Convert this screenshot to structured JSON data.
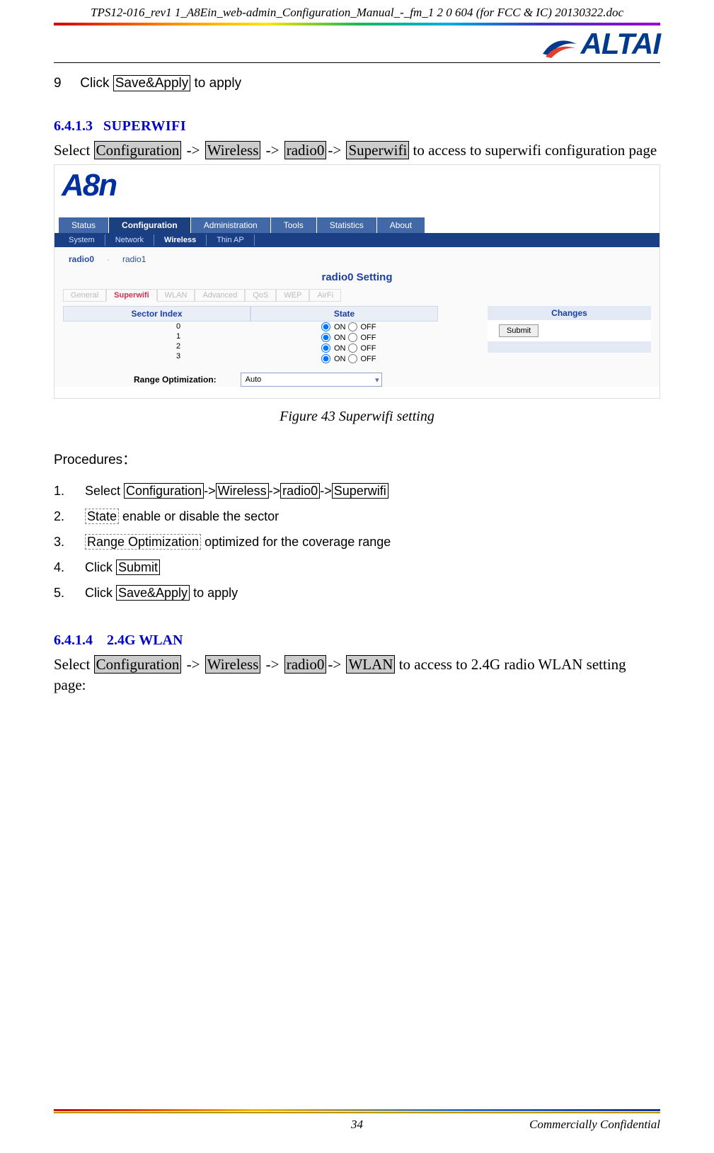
{
  "doc": {
    "header": "TPS12-016_rev1 1_A8Ein_web-admin_Configuration_Manual_-_fm_1 2 0 604 (for FCC & IC) 20130322.doc",
    "logo": "ALTAI"
  },
  "step9": {
    "num": "9",
    "pre": "Click ",
    "btn": "Save&Apply",
    "post": " to apply"
  },
  "sec_6413": {
    "num": "6.4.1.3",
    "title": "SUPERWIFI",
    "lead": "Select ",
    "b1": "Configuration",
    "arrow": " -> ",
    "b2": "Wireless",
    "b3": "radio0",
    "arrow2": "-> ",
    "b4": "Superwifi",
    "tail": " to access to superwifi configuration page"
  },
  "fig": {
    "logo": "A8n",
    "tabs1": [
      "Status",
      "Configuration",
      "Administration",
      "Tools",
      "Statistics",
      "About"
    ],
    "active1": 1,
    "subtabs": [
      "System",
      "Network",
      "Wireless",
      "Thin AP"
    ],
    "subactive": 2,
    "radios": [
      "radio0",
      "radio1"
    ],
    "rsep": "-",
    "ractive": 0,
    "title": "radio0 Setting",
    "ctabs": [
      "General",
      "Superwifi",
      "WLAN",
      "Advanced",
      "QoS",
      "WEP",
      "AirFi"
    ],
    "cactive": 1,
    "th1": "Sector Index",
    "th2": "State",
    "sectors": [
      "0",
      "1",
      "2",
      "3"
    ],
    "on": "ON",
    "off": "OFF",
    "range_label": "Range Optimization:",
    "range_val": "Auto",
    "changes": "Changes",
    "submit": "Submit"
  },
  "caption": "Figure 43 Superwifi setting",
  "procedures_label": "Procedures：",
  "proc": {
    "p1": {
      "n": "1.",
      "pre": "Select ",
      "a": "Configuration",
      "b": "Wireless",
      "c": "radio0",
      "d": "Superwifi",
      "sep": "->"
    },
    "p2": {
      "n": "2.",
      "a": "State",
      "t": " enable or disable the sector"
    },
    "p3": {
      "n": "3.",
      "a": "Range Optimization",
      "t": " optimized for the coverage range"
    },
    "p4": {
      "n": "4.",
      "pre": "Click ",
      "a": "Submit"
    },
    "p5": {
      "n": "5.",
      "pre": "Click ",
      "a": "Save&Apply",
      "t": " to apply"
    }
  },
  "sec_6414": {
    "num": "6.4.1.4",
    "title": "2.4G WLAN",
    "lead": "Select ",
    "b1": "Configuration",
    "arrow": " -> ",
    "b2": "Wireless",
    "b3": "radio0",
    "arrow2": "-> ",
    "b4": "WLAN",
    "tail": " to access to 2.4G radio WLAN setting page:"
  },
  "footer": {
    "page": "34",
    "conf": "Commercially Confidential"
  }
}
